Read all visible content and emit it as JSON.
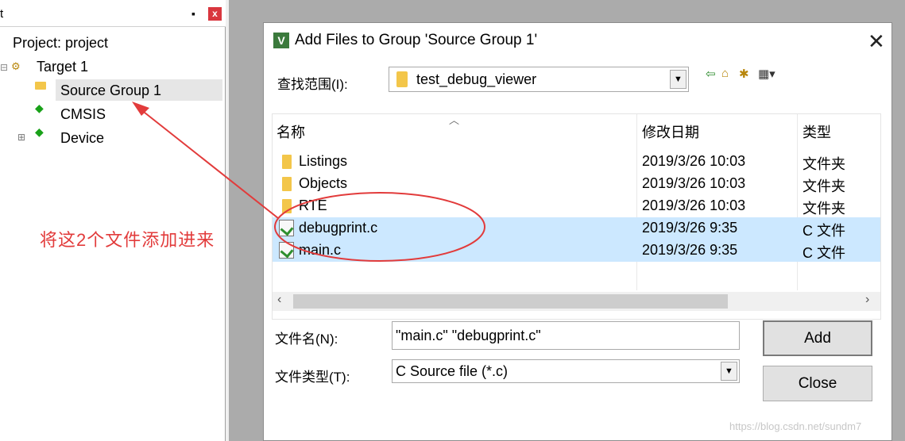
{
  "left_panel": {
    "title": "t",
    "pin_glyph": "▪",
    "close_glyph": "x",
    "tree": {
      "project": "Project: project",
      "target": "Target 1",
      "source_group": "Source Group 1",
      "cmsis": "CMSIS",
      "device": "Device",
      "expand_glyph": "⊞"
    }
  },
  "dialog": {
    "app_icon": "V",
    "title": "Add Files to Group 'Source Group 1'",
    "close_glyph": "✕",
    "look_in_label": "查找范围(I):",
    "look_in_value": "test_debug_viewer",
    "toolbar_icons": [
      "back-icon",
      "up-folder-icon",
      "new-folder-icon",
      "view-menu-icon"
    ],
    "columns": {
      "name": "名称",
      "date": "修改日期",
      "type": "类型"
    },
    "files": [
      {
        "name": "Listings",
        "date": "2019/3/26 10:03",
        "type": "文件夹",
        "kind": "folder",
        "selected": false
      },
      {
        "name": "Objects",
        "date": "2019/3/26 10:03",
        "type": "文件夹",
        "kind": "folder",
        "selected": false
      },
      {
        "name": "RTE",
        "date": "2019/3/26 10:03",
        "type": "文件夹",
        "kind": "folder",
        "selected": false
      },
      {
        "name": "debugprint.c",
        "date": "2019/3/26 9:35",
        "type": "C 文件",
        "kind": "c-file",
        "selected": true
      },
      {
        "name": "main.c",
        "date": "2019/3/26 9:35",
        "type": "C 文件",
        "kind": "c-file",
        "selected": true
      }
    ],
    "filename_label": "文件名(N):",
    "filename_value": "\"main.c\" \"debugprint.c\"",
    "filetype_label": "文件类型(T):",
    "filetype_value": "C Source file (*.c)",
    "add_label": "Add",
    "close_label": "Close"
  },
  "annotation": {
    "text": "将这2个文件添加进来",
    "color": "#e23b3b"
  },
  "watermark": "https://blog.csdn.net/sundm7"
}
